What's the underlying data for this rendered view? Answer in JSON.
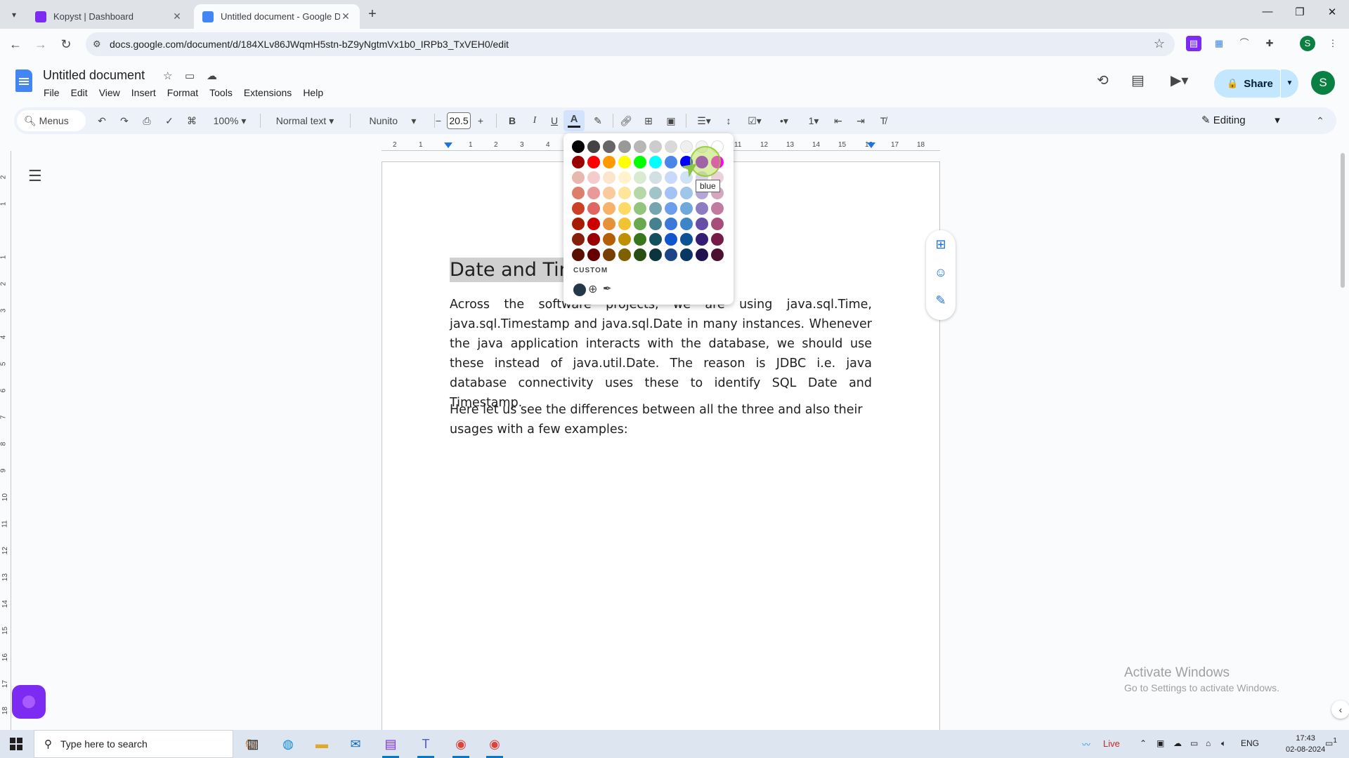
{
  "browser": {
    "tabs": [
      {
        "title": "Kopyst | Dashboard",
        "favicon_color": "#7c2bf2",
        "active": false
      },
      {
        "title": "Untitled document - Google Do",
        "favicon_color": "#4285f4",
        "active": true
      }
    ],
    "url": "docs.google.com/document/d/184XLv86JWqmH5stn-bZ9yNgtmVx1b0_IRPb3_TxVEH0/edit",
    "profile_initial": "S"
  },
  "docs": {
    "title": "Untitled document",
    "menu": [
      "File",
      "Edit",
      "View",
      "Insert",
      "Format",
      "Tools",
      "Extensions",
      "Help"
    ],
    "share_label": "Share",
    "avatar_initial": "S",
    "toolbar": {
      "menus_label": "Menus",
      "zoom": "100%",
      "style": "Normal text",
      "font": "Nunito",
      "font_size": "20.5",
      "bold": "B",
      "italic": "I",
      "underline": "U",
      "mode": "Editing"
    },
    "ruler_ticks": [
      "2",
      "1",
      "1",
      "2",
      "3",
      "4",
      "11",
      "12",
      "13",
      "14",
      "15",
      "16",
      "17",
      "18"
    ],
    "vruler_ticks": [
      "2",
      "1",
      "1",
      "2",
      "3",
      "4",
      "5",
      "6",
      "7",
      "8",
      "9",
      "10",
      "11",
      "12",
      "13",
      "14",
      "15",
      "16",
      "17",
      "18"
    ],
    "content": {
      "heading": "Date and Tim",
      "para1": "Across the software projects, we are using java.sql.Time, java.sql.Timestamp and java.sql.Date in many instances. Whenever the java application interacts with the database, we should use these instead of java.util.Date. The reason is JDBC i.e. java database connectivity uses these to identify SQL Date and Timestamp.",
      "para2": "Here let us see the differences between all the three and also their usages with a few examples:"
    }
  },
  "palette": {
    "rows": [
      [
        "#000000",
        "#434343",
        "#666666",
        "#999999",
        "#b7b7b7",
        "#cccccc",
        "#d9d9d9",
        "#efefef",
        "#f3f3f3",
        "#ffffff"
      ],
      [
        "#980000",
        "#ff0000",
        "#ff9900",
        "#ffff00",
        "#00ff00",
        "#00ffff",
        "#4a86e8",
        "#0000ff",
        "#9900ff",
        "#ff00ff"
      ],
      [
        "#e6b8af",
        "#f4cccc",
        "#fce5cd",
        "#fff2cc",
        "#d9ead3",
        "#d0e0e3",
        "#c9daf8",
        "#cfe2f3",
        "#d9d2e9",
        "#ead1dc"
      ],
      [
        "#dd7e6b",
        "#ea9999",
        "#f9cb9c",
        "#ffe599",
        "#b6d7a8",
        "#a2c4c9",
        "#a4c2f4",
        "#9fc5e8",
        "#b4a7d6",
        "#d5a6bd"
      ],
      [
        "#cc4125",
        "#e06666",
        "#f6b26b",
        "#ffd966",
        "#93c47d",
        "#76a5af",
        "#6d9eeb",
        "#6fa8dc",
        "#8e7cc3",
        "#c27ba0"
      ],
      [
        "#a61c00",
        "#cc0000",
        "#e69138",
        "#f1c232",
        "#6aa84f",
        "#45818e",
        "#3c78d8",
        "#3d85c6",
        "#674ea7",
        "#a64d79"
      ],
      [
        "#85200c",
        "#990000",
        "#b45f06",
        "#bf9000",
        "#38761d",
        "#134f5c",
        "#1155cc",
        "#0b5394",
        "#351c75",
        "#741b47"
      ],
      [
        "#5b0f00",
        "#660000",
        "#783f04",
        "#7f6000",
        "#274e13",
        "#0c343d",
        "#1c4587",
        "#073763",
        "#20124d",
        "#4c1130"
      ]
    ],
    "custom_label": "CUSTOM",
    "custom_color": "#24384a",
    "tooltip": "blue"
  },
  "watermark": {
    "line1": "Activate Windows",
    "line2": "Go to Settings to activate Windows."
  },
  "taskbar": {
    "search_placeholder": "Type here to search",
    "live_label": "Live",
    "lang": "ENG",
    "time": "17:43",
    "date": "02-08-2024",
    "notification_count": "1"
  }
}
